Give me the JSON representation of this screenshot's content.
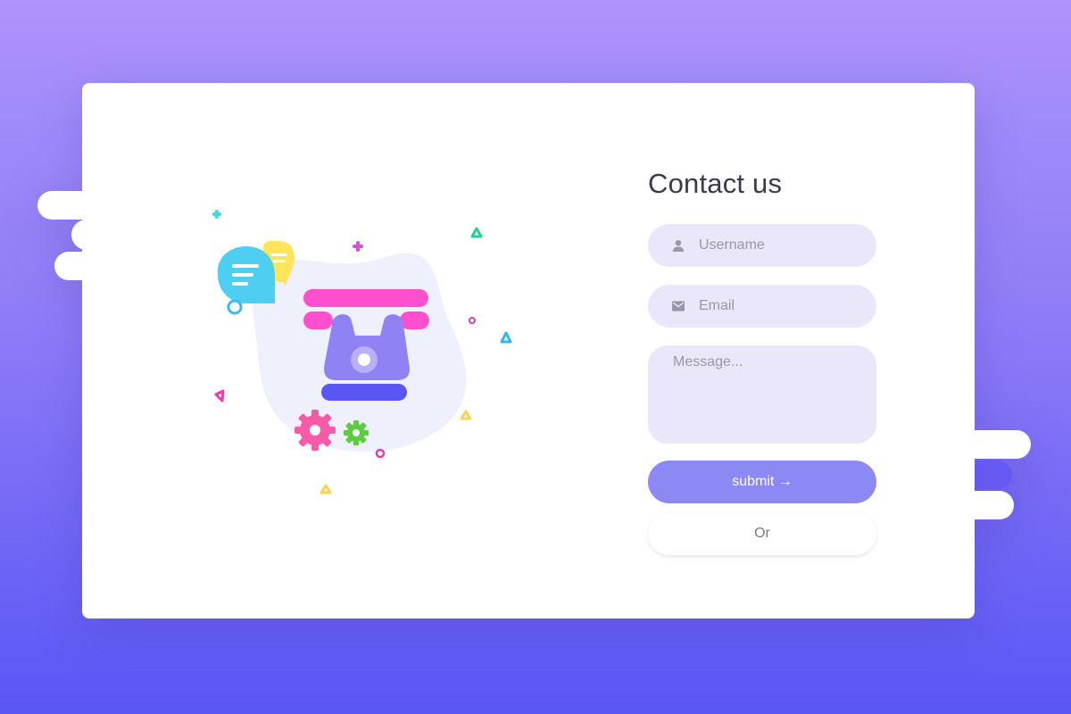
{
  "contact_form": {
    "title": "Contact us",
    "username": {
      "placeholder": "Username",
      "icon": "user-icon"
    },
    "email": {
      "placeholder": "Email",
      "icon": "mail-icon"
    },
    "message": {
      "placeholder": "Message..."
    },
    "submit_label": "submit →",
    "or_label": "Or"
  },
  "colors": {
    "accent": "#8c88f4",
    "field_bg": "#ebe7fb",
    "background_top": "#ad93fb",
    "background_bottom": "#5a56f6"
  },
  "illustration": {
    "subject": "telephone-with-chat-bubbles"
  }
}
